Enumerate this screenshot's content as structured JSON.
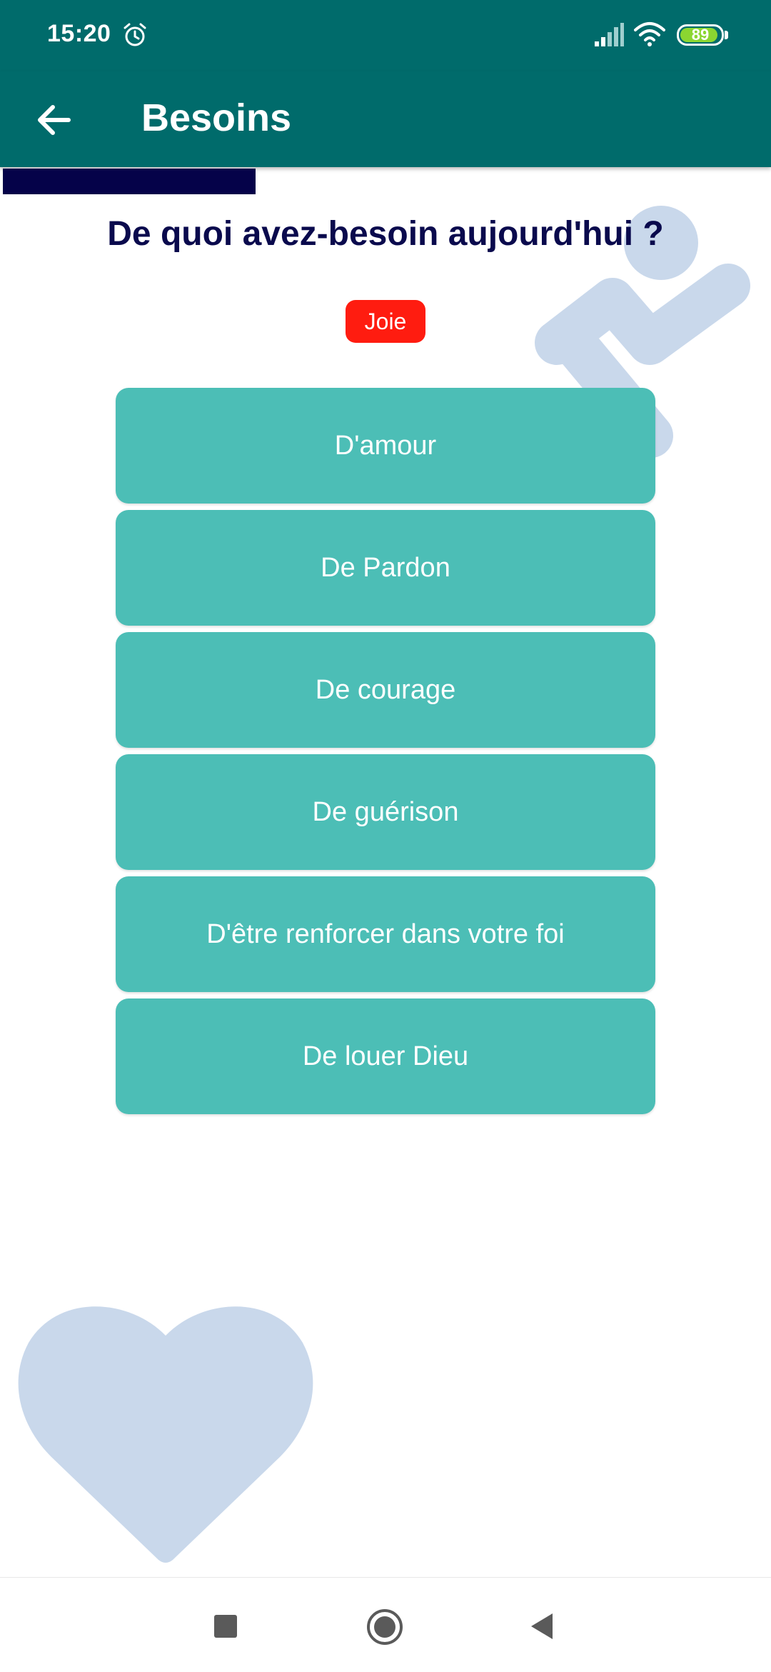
{
  "status_bar": {
    "time": "15:20",
    "battery_level": "89",
    "icons": [
      "alarm-icon",
      "signal-icon",
      "wifi-icon",
      "battery-icon"
    ]
  },
  "app_bar": {
    "title": "Besoins",
    "back_icon": "arrow-left-icon"
  },
  "progress": {
    "fraction": 0.33
  },
  "main": {
    "question": "De quoi avez-besoin aujourd'hui ?",
    "emotion_badge": "Joie",
    "options": [
      {
        "label": "D'amour"
      },
      {
        "label": "De Pardon"
      },
      {
        "label": "De courage"
      },
      {
        "label": "De guérison"
      },
      {
        "label": "D'être renforcer dans votre foi"
      },
      {
        "label": "De louer Dieu"
      }
    ]
  },
  "decorations": [
    "runner-figure-icon",
    "heart-icon"
  ],
  "nav_bar": {
    "icons": [
      "recents-square-icon",
      "home-circle-icon",
      "back-triangle-icon"
    ]
  },
  "colors": {
    "header": "#006b6b",
    "progress": "#050249",
    "question_text": "#0a0a4d",
    "badge": "#ff1c10",
    "option_button": "#4cbeb6",
    "decoration": "#c9d8eb"
  }
}
